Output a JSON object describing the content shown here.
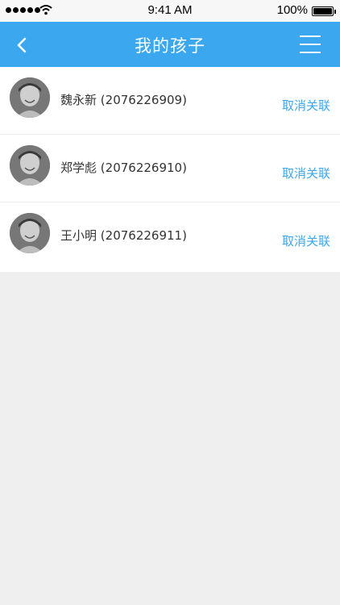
{
  "status_bar": {
    "time": "9:41 AM",
    "battery": "100%",
    "signal_icon": "signal-dots-icon",
    "wifi_icon": "wifi-icon",
    "battery_icon": "battery-icon"
  },
  "nav": {
    "title": "我的孩子",
    "back_icon": "chevron-left-icon",
    "menu_icon": "hamburger-menu-icon"
  },
  "children": [
    {
      "name": "魏永新",
      "id": "(2076226909)",
      "action": "取消关联"
    },
    {
      "name": "郑学彪",
      "id": "(2076226910)",
      "action": "取消关联"
    },
    {
      "name": "王小明",
      "id": "(2076226911)",
      "action": "取消关联"
    }
  ],
  "colors": {
    "accent": "#3ba7ee",
    "background": "#efefef",
    "text": "#333333"
  }
}
